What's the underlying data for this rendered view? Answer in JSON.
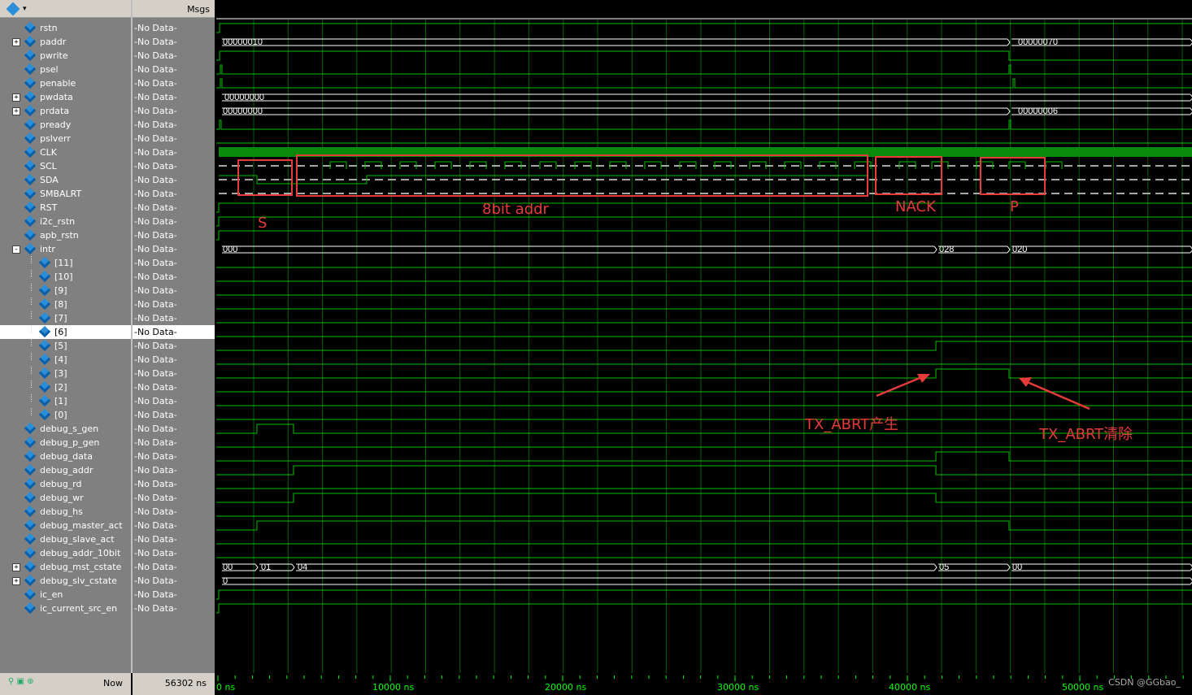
{
  "header": {
    "msgs_label": "Msgs"
  },
  "signals": [
    {
      "name": "rstn",
      "value": "-No Data-",
      "expander": "",
      "indent": 0
    },
    {
      "name": "paddr",
      "value": "-No Data-",
      "expander": "+",
      "indent": 0
    },
    {
      "name": "pwrite",
      "value": "-No Data-",
      "expander": "",
      "indent": 0
    },
    {
      "name": "psel",
      "value": "-No Data-",
      "expander": "",
      "indent": 0
    },
    {
      "name": "penable",
      "value": "-No Data-",
      "expander": "",
      "indent": 0
    },
    {
      "name": "pwdata",
      "value": "-No Data-",
      "expander": "+",
      "indent": 0
    },
    {
      "name": "prdata",
      "value": "-No Data-",
      "expander": "+",
      "indent": 0
    },
    {
      "name": "pready",
      "value": "-No Data-",
      "expander": "",
      "indent": 0
    },
    {
      "name": "pslverr",
      "value": "-No Data-",
      "expander": "",
      "indent": 0
    },
    {
      "name": "CLK",
      "value": "-No Data-",
      "expander": "",
      "indent": 0
    },
    {
      "name": "SCL",
      "value": "-No Data-",
      "expander": "",
      "indent": 0
    },
    {
      "name": "SDA",
      "value": "-No Data-",
      "expander": "",
      "indent": 0
    },
    {
      "name": "SMBALRT",
      "value": "-No Data-",
      "expander": "",
      "indent": 0
    },
    {
      "name": "RST",
      "value": "-No Data-",
      "expander": "",
      "indent": 0
    },
    {
      "name": "i2c_rstn",
      "value": "-No Data-",
      "expander": "",
      "indent": 0
    },
    {
      "name": "apb_rstn",
      "value": "-No Data-",
      "expander": "",
      "indent": 0
    },
    {
      "name": "intr",
      "value": "-No Data-",
      "expander": "-",
      "indent": 0
    },
    {
      "name": "[11]",
      "value": "-No Data-",
      "expander": "",
      "indent": 1
    },
    {
      "name": "[10]",
      "value": "-No Data-",
      "expander": "",
      "indent": 1
    },
    {
      "name": "[9]",
      "value": "-No Data-",
      "expander": "",
      "indent": 1
    },
    {
      "name": "[8]",
      "value": "-No Data-",
      "expander": "",
      "indent": 1
    },
    {
      "name": "[7]",
      "value": "-No Data-",
      "expander": "",
      "indent": 1
    },
    {
      "name": "[6]",
      "value": "-No Data-",
      "expander": "",
      "indent": 1,
      "selected": true
    },
    {
      "name": "[5]",
      "value": "-No Data-",
      "expander": "",
      "indent": 1
    },
    {
      "name": "[4]",
      "value": "-No Data-",
      "expander": "",
      "indent": 1
    },
    {
      "name": "[3]",
      "value": "-No Data-",
      "expander": "",
      "indent": 1
    },
    {
      "name": "[2]",
      "value": "-No Data-",
      "expander": "",
      "indent": 1
    },
    {
      "name": "[1]",
      "value": "-No Data-",
      "expander": "",
      "indent": 1
    },
    {
      "name": "[0]",
      "value": "-No Data-",
      "expander": "",
      "indent": 1
    },
    {
      "name": "debug_s_gen",
      "value": "-No Data-",
      "expander": "",
      "indent": 0
    },
    {
      "name": "debug_p_gen",
      "value": "-No Data-",
      "expander": "",
      "indent": 0
    },
    {
      "name": "debug_data",
      "value": "-No Data-",
      "expander": "",
      "indent": 0
    },
    {
      "name": "debug_addr",
      "value": "-No Data-",
      "expander": "",
      "indent": 0
    },
    {
      "name": "debug_rd",
      "value": "-No Data-",
      "expander": "",
      "indent": 0
    },
    {
      "name": "debug_wr",
      "value": "-No Data-",
      "expander": "",
      "indent": 0
    },
    {
      "name": "debug_hs",
      "value": "-No Data-",
      "expander": "",
      "indent": 0
    },
    {
      "name": "debug_master_act",
      "value": "-No Data-",
      "expander": "",
      "indent": 0
    },
    {
      "name": "debug_slave_act",
      "value": "-No Data-",
      "expander": "",
      "indent": 0
    },
    {
      "name": "debug_addr_10bit",
      "value": "-No Data-",
      "expander": "",
      "indent": 0
    },
    {
      "name": "debug_mst_cstate",
      "value": "-No Data-",
      "expander": "+",
      "indent": 0
    },
    {
      "name": "debug_slv_cstate",
      "value": "-No Data-",
      "expander": "+",
      "indent": 0
    },
    {
      "name": "ic_en",
      "value": "-No Data-",
      "expander": "",
      "indent": 0
    },
    {
      "name": "ic_current_src_en",
      "value": "-No Data-",
      "expander": "",
      "indent": 0
    }
  ],
  "bus_values": {
    "paddr": [
      "00000010",
      "00000070"
    ],
    "pwdata": [
      "00000000"
    ],
    "prdata": [
      "00000000",
      "00000006"
    ],
    "intr": [
      "000",
      "028",
      "020"
    ],
    "debug_mst_cstate": [
      "00",
      "01",
      "04",
      "05",
      "00"
    ],
    "debug_slv_cstate": [
      "0"
    ]
  },
  "footer": {
    "now_label": "Now",
    "now_value": "56302 ns"
  },
  "timeline": {
    "labels": [
      "0 ns",
      "10000 ns",
      "20000 ns",
      "30000 ns",
      "40000 ns",
      "50000 ns"
    ]
  },
  "annotations": {
    "start": "S",
    "addr": "8bit addr",
    "nack": "NACK",
    "stop": "P",
    "tx_abrt_set": "TX_ABRT产生",
    "tx_abrt_clear": "TX_ABRT清除"
  },
  "watermark": "CSDN @GGbao_",
  "colors": {
    "wave": "#00c000",
    "annotation": "#e53b3b",
    "grid": "#00a000"
  }
}
